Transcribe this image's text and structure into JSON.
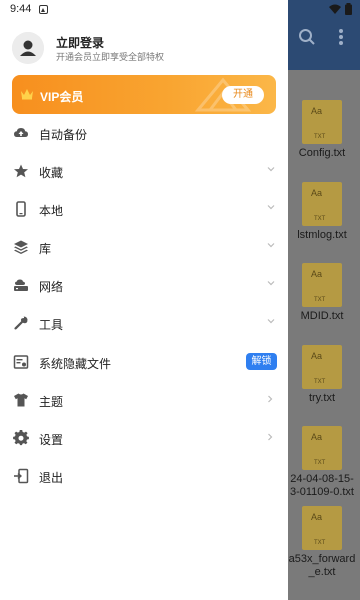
{
  "statusbar": {
    "time": "9:44"
  },
  "background": {
    "files": [
      {
        "name": "Config.txt"
      },
      {
        "name": "lstmlog.txt"
      },
      {
        "name": "MDID.txt"
      },
      {
        "name": "try.txt"
      },
      {
        "name": "24-04-08-15-\n3-01109-0.txt"
      },
      {
        "name": "a53x_forward\n_e.txt"
      }
    ]
  },
  "drawer": {
    "login_title": "立即登录",
    "login_subtitle": "开通会员立即享受全部特权",
    "vip_label": "VIP会员",
    "vip_button": "开通",
    "items": [
      {
        "label": "自动备份",
        "icon": "cloud-backup-icon"
      },
      {
        "label": "收藏",
        "icon": "star-icon"
      },
      {
        "label": "本地",
        "icon": "phone-icon"
      },
      {
        "label": "库",
        "icon": "layers-icon"
      },
      {
        "label": "网络",
        "icon": "network-drive-icon"
      },
      {
        "label": "工具",
        "icon": "wrench-icon"
      },
      {
        "label": "系统隐藏文件",
        "icon": "hidden-file-icon",
        "badge": "解锁"
      },
      {
        "label": "主题",
        "icon": "shirt-icon"
      },
      {
        "label": "设置",
        "icon": "gear-icon"
      },
      {
        "label": "退出",
        "icon": "exit-icon"
      }
    ]
  },
  "colors": {
    "vip_orange": "#f78f1e",
    "unlock_blue": "#2f7ff0",
    "toolbar_navy": "#2c4a73"
  }
}
